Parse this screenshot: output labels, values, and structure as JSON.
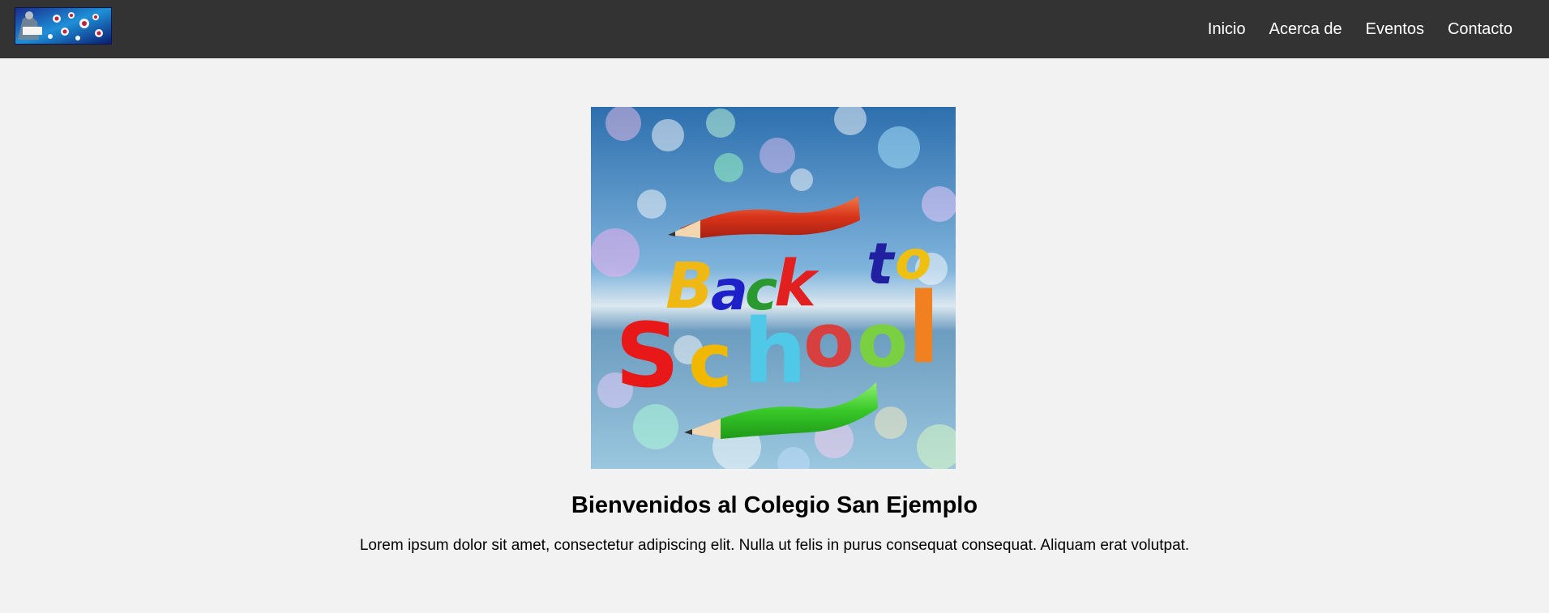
{
  "header": {
    "logo_alt": "Colegio San Ejemplo logo",
    "nav": [
      {
        "label": "Inicio"
      },
      {
        "label": "Acerca de"
      },
      {
        "label": "Eventos"
      },
      {
        "label": "Contacto"
      }
    ]
  },
  "main": {
    "hero_words": {
      "line1": [
        "Back",
        "to"
      ],
      "line2": [
        "S",
        "c",
        "h",
        "o",
        "o",
        "l"
      ]
    },
    "title": "Bienvenidos al Colegio San Ejemplo",
    "text": "Lorem ipsum dolor sit amet, consectetur adipiscing elit. Nulla ut felis in purus consequat consequat. Aliquam erat volutpat."
  },
  "colors": {
    "navbar": "#333333",
    "page_background": "#f2f2f2",
    "nav_text": "#ffffff"
  }
}
